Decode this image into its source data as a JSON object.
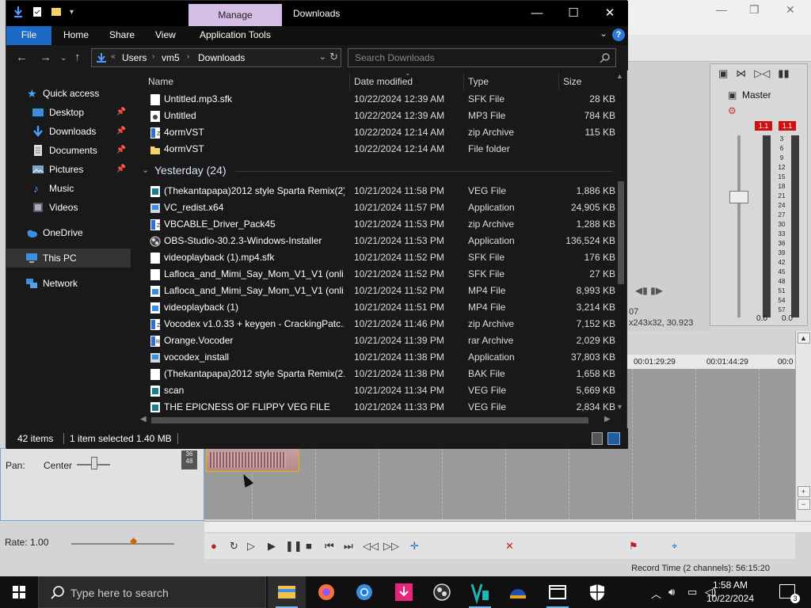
{
  "background_app": {
    "mixer": {
      "master_label": "Master",
      "peak_left": "1.1",
      "peak_right": "1.1",
      "scale": [
        "3",
        "6",
        "9",
        "12",
        "15",
        "18",
        "21",
        "24",
        "27",
        "30",
        "33",
        "36",
        "39",
        "42",
        "45",
        "48",
        "51",
        "54",
        "57"
      ],
      "zero_left": "0.0",
      "zero_right": "0.0"
    },
    "coords_line1": "07",
    "coords_line2": "x243x32, 30.923",
    "ruler": [
      "00:01:29:29",
      "00:01:44:29",
      "00:0"
    ],
    "track": {
      "pan_label": "Pan:",
      "pan_value": "Center",
      "meter_values": [
        "36",
        "48"
      ]
    },
    "rate_label": "Rate: 1.00",
    "record_time": "Record Time (2 channels): 56:15:20"
  },
  "explorer": {
    "manage_tab": "Manage",
    "title": "Downloads",
    "ribbon_tabs": [
      "File",
      "Home",
      "Share",
      "View",
      "Application Tools"
    ],
    "breadcrumb": [
      "Users",
      "vm5",
      "Downloads"
    ],
    "breadcrumb_prefix": "«",
    "search_placeholder": "Search Downloads",
    "nav_items": [
      {
        "label": "Quick access",
        "pinned": false
      },
      {
        "label": "Desktop",
        "pinned": true
      },
      {
        "label": "Downloads",
        "pinned": true
      },
      {
        "label": "Documents",
        "pinned": true
      },
      {
        "label": "Pictures",
        "pinned": true
      },
      {
        "label": "Music",
        "pinned": false
      },
      {
        "label": "Videos",
        "pinned": false
      },
      {
        "label": "OneDrive",
        "pinned": false
      },
      {
        "label": "This PC",
        "pinned": false
      },
      {
        "label": "Network",
        "pinned": false
      }
    ],
    "columns": [
      "Name",
      "Date modified",
      "Type",
      "Size"
    ],
    "today_files": [
      {
        "name": "Untitled.mp3.sfk",
        "date": "10/22/2024 12:39 AM",
        "type": "SFK File",
        "size": "28 KB",
        "icon": "document-icon"
      },
      {
        "name": "Untitled",
        "date": "10/22/2024 12:39 AM",
        "type": "MP3 File",
        "size": "784 KB",
        "icon": "audio-file-icon"
      },
      {
        "name": "4ormVST",
        "date": "10/22/2024 12:14 AM",
        "type": "zip Archive",
        "size": "115 KB",
        "icon": "zip-archive-icon"
      },
      {
        "name": "4ormVST",
        "date": "10/22/2024 12:14 AM",
        "type": "File folder",
        "size": "",
        "icon": "folder-icon"
      }
    ],
    "group_label": "Yesterday (24)",
    "yesterday_files": [
      {
        "name": "(Thekantapapa)2012 style Sparta Remix(2)",
        "date": "10/21/2024 11:58 PM",
        "type": "VEG File",
        "size": "1,886 KB",
        "icon": "veg-file-icon"
      },
      {
        "name": "VC_redist.x64",
        "date": "10/21/2024 11:57 PM",
        "type": "Application",
        "size": "24,905 KB",
        "icon": "installer-icon"
      },
      {
        "name": "VBCABLE_Driver_Pack45",
        "date": "10/21/2024 11:53 PM",
        "type": "zip Archive",
        "size": "1,288 KB",
        "icon": "zip-archive-icon"
      },
      {
        "name": "OBS-Studio-30.2.3-Windows-Installer",
        "date": "10/21/2024 11:53 PM",
        "type": "Application",
        "size": "136,524 KB",
        "icon": "obs-icon"
      },
      {
        "name": "videoplayback (1).mp4.sfk",
        "date": "10/21/2024 11:52 PM",
        "type": "SFK File",
        "size": "176 KB",
        "icon": "document-icon"
      },
      {
        "name": "Lafloca_and_Mimi_Say_Mom_V1_V1 (onli...",
        "date": "10/21/2024 11:52 PM",
        "type": "SFK File",
        "size": "27 KB",
        "icon": "document-icon"
      },
      {
        "name": "Lafloca_and_Mimi_Say_Mom_V1_V1 (onli...",
        "date": "10/21/2024 11:52 PM",
        "type": "MP4 File",
        "size": "8,993 KB",
        "icon": "video-file-icon"
      },
      {
        "name": "videoplayback (1)",
        "date": "10/21/2024 11:51 PM",
        "type": "MP4 File",
        "size": "3,214 KB",
        "icon": "video-file-icon"
      },
      {
        "name": "Vocodex v1.0.33 + keygen - CrackingPatc...",
        "date": "10/21/2024 11:46 PM",
        "type": "zip Archive",
        "size": "7,152 KB",
        "icon": "zip-archive-icon"
      },
      {
        "name": "Orange.Vocoder",
        "date": "10/21/2024 11:39 PM",
        "type": "rar Archive",
        "size": "2,029 KB",
        "icon": "rar-archive-icon"
      },
      {
        "name": "vocodex_install",
        "date": "10/21/2024 11:38 PM",
        "type": "Application",
        "size": "37,803 KB",
        "icon": "installer-icon"
      },
      {
        "name": "(Thekantapapa)2012 style Sparta Remix(2...",
        "date": "10/21/2024 11:38 PM",
        "type": "BAK File",
        "size": "1,658 KB",
        "icon": "document-icon"
      },
      {
        "name": "scan",
        "date": "10/21/2024 11:34 PM",
        "type": "VEG File",
        "size": "5,669 KB",
        "icon": "veg-file-icon"
      },
      {
        "name": "THE EPICNESS OF FLIPPY VEG FILE",
        "date": "10/21/2024 11:33 PM",
        "type": "VEG File",
        "size": "2,834 KB",
        "icon": "veg-file-icon"
      }
    ],
    "status": {
      "items": "42 items",
      "selected": "1 item selected",
      "size": "1.40 MB"
    }
  },
  "taskbar": {
    "search_text": "Type here to search",
    "apps": [
      "file-explorer-icon",
      "firefox-icon",
      "chrome-icon",
      "download-app-icon",
      "obs-icon",
      "vegas-icon",
      "media-app-icon",
      "clapperboard-icon",
      "security-shield-icon"
    ],
    "time": "1:58 AM",
    "date": "10/22/2024",
    "notification_count": "3"
  },
  "colors": {
    "accent_blue": "#1b6ac6",
    "manage_tab": "#d6bde8",
    "explorer_bg": "#191919",
    "peak_red": "#d01010"
  }
}
